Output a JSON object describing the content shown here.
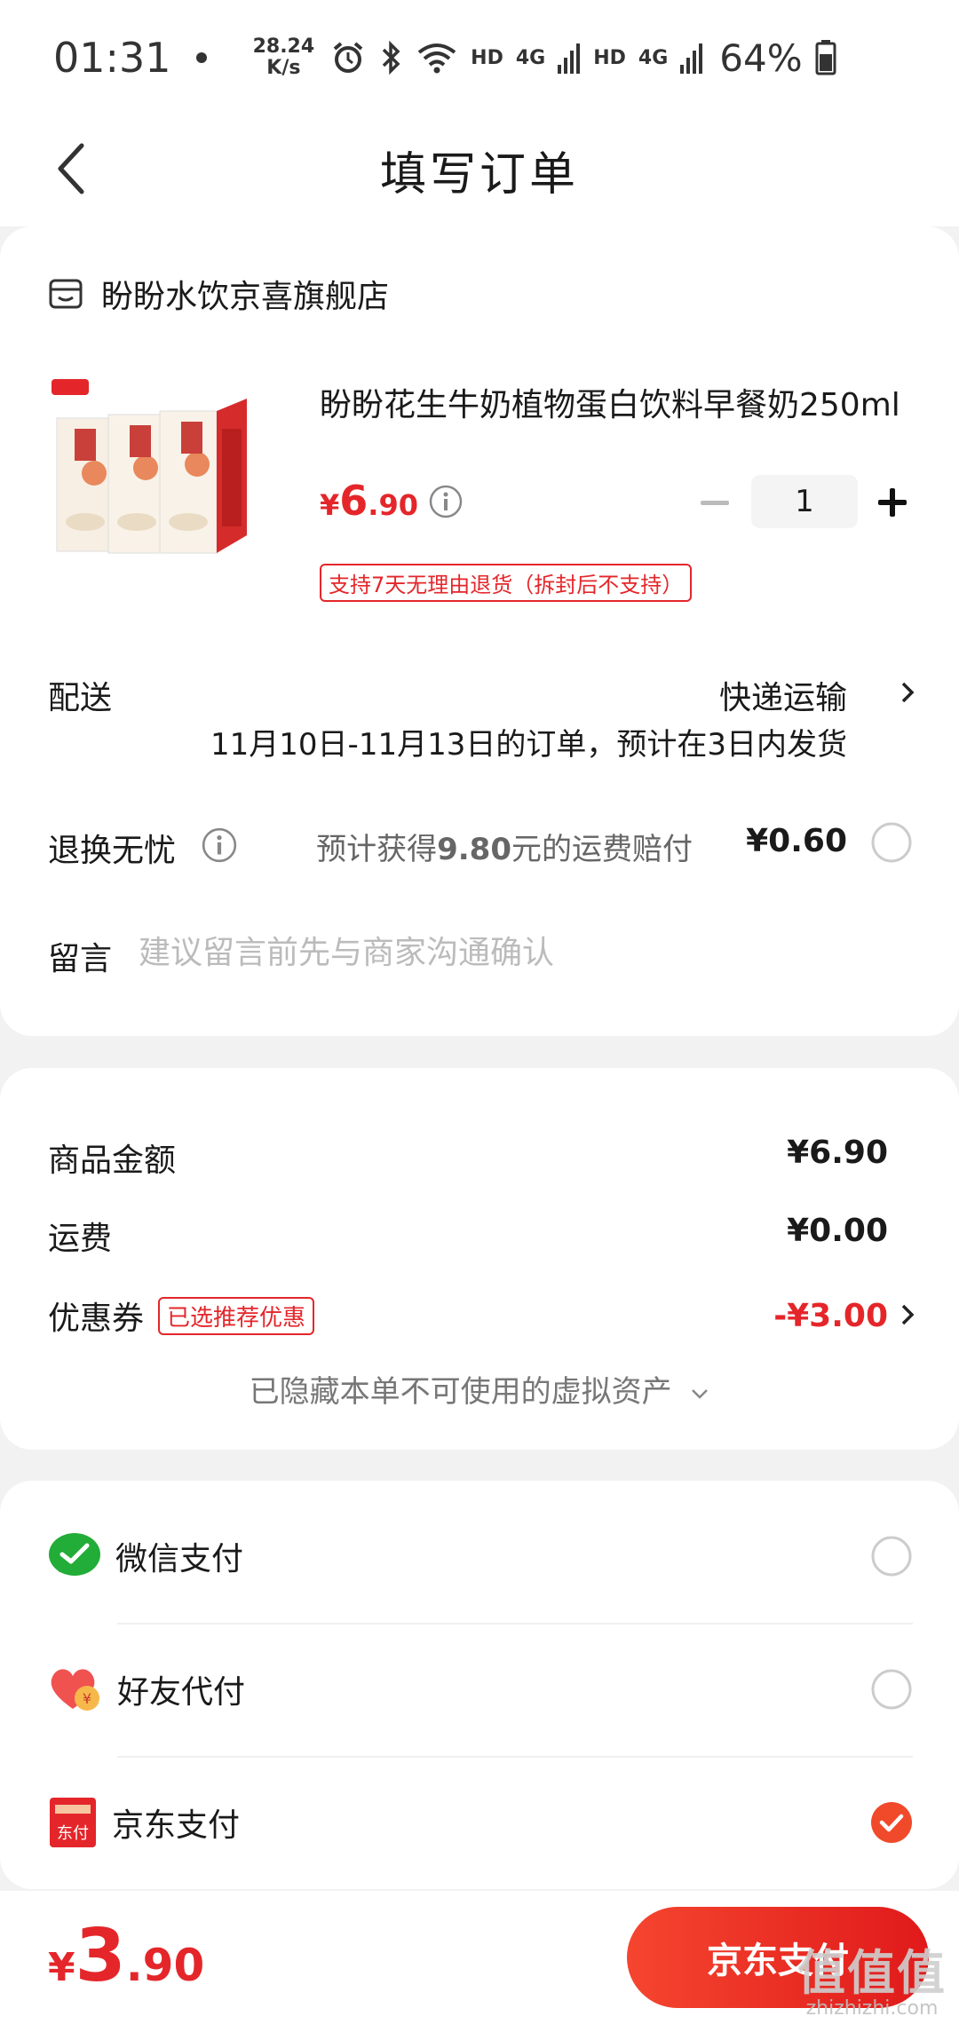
{
  "status_bar": {
    "time": "01:31",
    "speed_value": "28.24",
    "speed_unit": "K/s",
    "net1": "HD",
    "net1_type": "4G",
    "net2": "HD",
    "net2_type": "4G",
    "battery": "64%"
  },
  "header": {
    "title": "填写订单"
  },
  "shop": {
    "name": "盼盼水饮京喜旗舰店"
  },
  "product": {
    "title": "盼盼花生牛奶植物蛋白饮料早餐奶250ml",
    "price_symbol": "¥",
    "price_int": "6",
    "price_dec": ".90",
    "quantity": "1",
    "return_tag": "支持7天无理由退货（拆封后不支持）"
  },
  "delivery": {
    "label": "配送",
    "value": "快递运输",
    "note": "11月10日-11月13日的订单，预计在3日内发货"
  },
  "exchange": {
    "label": "退换无忧",
    "text_prefix": "预计获得",
    "text_amount": "9.80",
    "text_suffix": "元的运费赔付",
    "price": "¥0.60"
  },
  "message": {
    "label": "留言",
    "placeholder": "建议留言前先与商家沟通确认"
  },
  "summary": {
    "goods_label": "商品金额",
    "goods_value": "¥6.90",
    "shipping_label": "运费",
    "shipping_value": "¥0.00",
    "coupon_label": "优惠券",
    "coupon_tag": "已选推荐优惠",
    "coupon_value": "-¥3.00",
    "hidden_assets": "已隐藏本单不可使用的虚拟资产"
  },
  "payment": {
    "options": [
      {
        "label": "微信支付",
        "selected": false
      },
      {
        "label": "好友代付",
        "selected": false
      },
      {
        "label": "京东支付",
        "selected": true
      }
    ],
    "jd_icon_text": "东付"
  },
  "bottom": {
    "total_symbol": "¥",
    "total_int": "3",
    "total_dec": ".90",
    "pay_button": "京东支付"
  },
  "watermark": {
    "big": "值值值",
    "small": "zhizhizhi.com"
  },
  "colors": {
    "accent": "#e4262a",
    "wechat": "#22ac38"
  }
}
